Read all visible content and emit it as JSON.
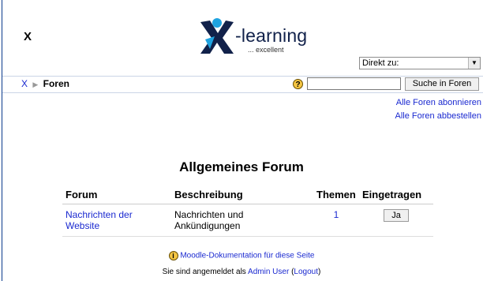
{
  "header": {
    "site_short": "X",
    "logo_main": "-learning",
    "logo_sub": "... excellent",
    "jump_label": "Direkt zu:"
  },
  "navbar": {
    "home": "X",
    "current": "Foren",
    "search_button": "Suche in Foren",
    "search_value": ""
  },
  "links": {
    "subscribe_all": "Alle Foren abonnieren",
    "unsubscribe_all": "Alle Foren abbestellen"
  },
  "forum_section": {
    "title": "Allgemeines Forum",
    "columns": [
      "Forum",
      "Beschreibung",
      "Themen",
      "Eingetragen"
    ],
    "rows": [
      {
        "forum": "Nachrichten der Website",
        "description": "Nachrichten und Ankündigungen",
        "topics": "1",
        "subscribed": "Ja"
      }
    ]
  },
  "footer": {
    "doc_link": "Moodle-Dokumentation für diese Seite",
    "logged_in_prefix": "Sie sind angemeldet als",
    "user": "Admin User",
    "logout": "Logout"
  },
  "colors": {
    "link": "#1a29d0",
    "logo_dark": "#11214a",
    "logo_accent": "#1fa3e0",
    "help_icon": "#f4c542"
  }
}
